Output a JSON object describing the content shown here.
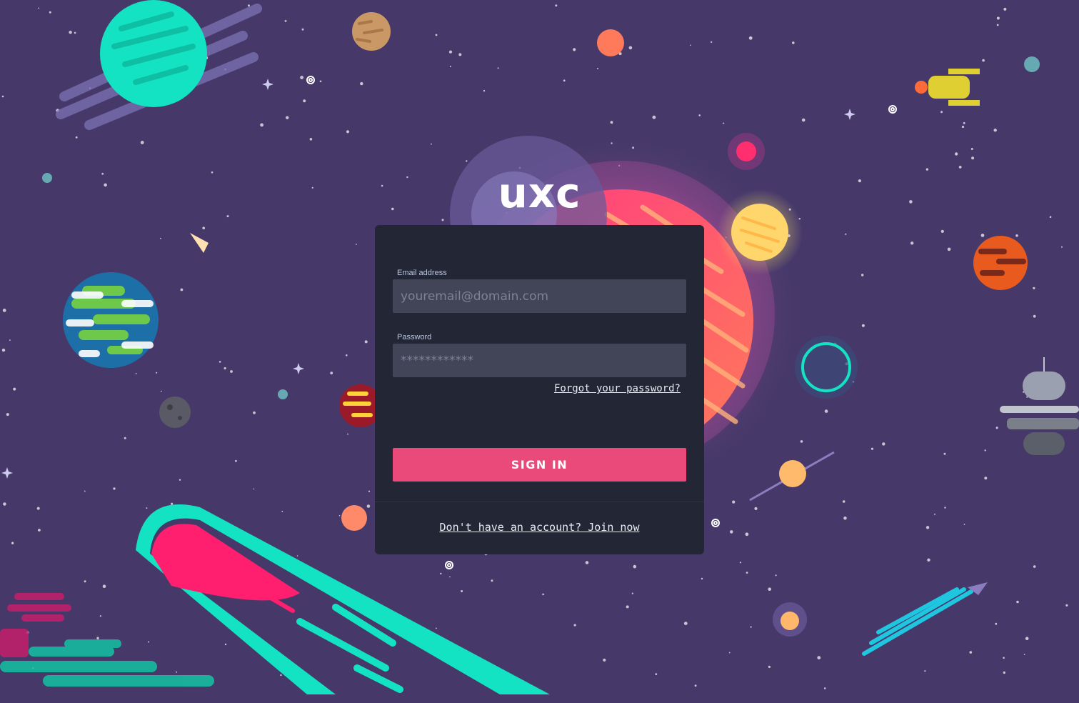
{
  "app": {
    "logo": "uxc"
  },
  "login_form": {
    "email_label": "Email address",
    "email_placeholder": "youremail@domain.com",
    "password_label": "Password",
    "password_placeholder": "************",
    "forgot_link": "Forgot your password?",
    "submit_label": "SIGN IN",
    "join_link": "Don't have an account? Join now"
  },
  "colors": {
    "background": "#46396a",
    "card": "#232634",
    "input": "#414557",
    "primary_button": "#ea4a7a",
    "accent_teal": "#13e3c3",
    "accent_pink": "#ff3b80"
  },
  "background_art": {
    "icons": [
      "ringed-planet-icon",
      "earth-planet-icon",
      "sun-icon",
      "comet-icon",
      "rocket-icon",
      "spaceship-icon",
      "space-station-icon",
      "satellite-icon",
      "moon-icon",
      "portal-ring-icon",
      "star-icon",
      "spiral-galaxy-icon"
    ]
  }
}
